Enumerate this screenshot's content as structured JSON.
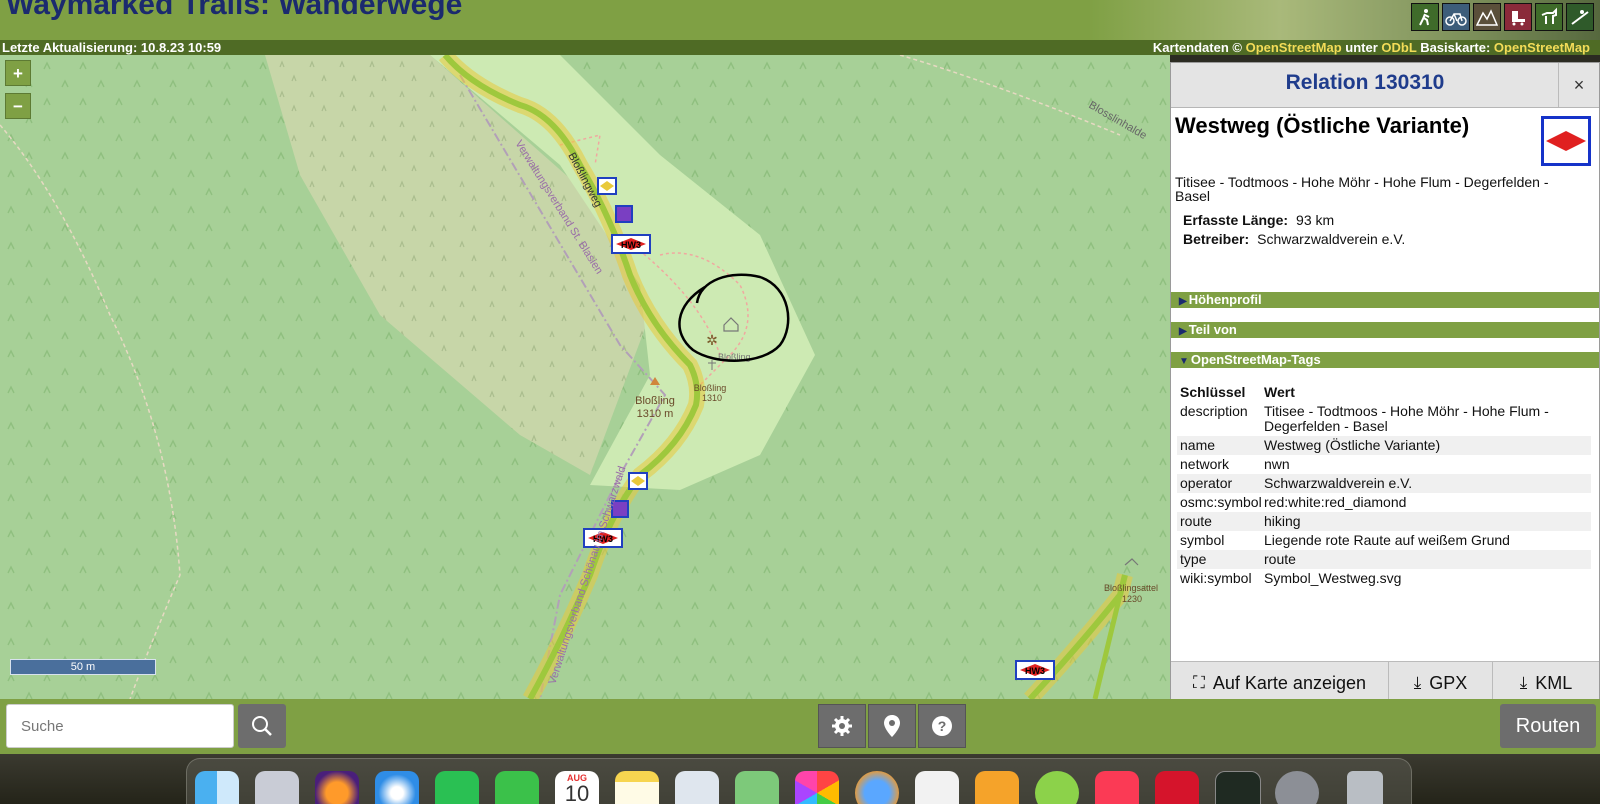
{
  "header": {
    "title": "Waymarked Trails: Wanderwege",
    "route_icons": [
      "hiking-icon",
      "cycling-icon",
      "mtb-icon",
      "skating-icon",
      "riding-icon",
      "slopes-icon"
    ],
    "last_update": "Letzte Aktualisierung: 10.8.23 10:59",
    "attribution": {
      "prefix": "Kartendaten ©",
      "osm": "OpenStreetMap",
      "under": "unter",
      "license": "ODbL",
      "base_label": "Basiskarte:",
      "base": "OpenStreetMap"
    }
  },
  "map": {
    "zoom_in": "+",
    "zoom_out": "−",
    "scale": "50 m",
    "labels": {
      "road": "Bloßlingweg",
      "admin1": "Verwaltungsverband St. Blasien",
      "admin2": "Verwaltungsverband Schönau im Schwarzwald",
      "peak_name": "Bloßling",
      "peak_ele": "1310 m",
      "peak2_name": "Bloßling",
      "peak2_ele": "1310",
      "shelter": "Bloßling",
      "east_road": "Blosslinhalde",
      "east_peak": "Bloßlingsattel",
      "east_peak_ele": "1230",
      "route_tag": "HW3"
    }
  },
  "panel": {
    "title": "Relation 130310",
    "close": "×",
    "route_name": "Westweg (Östliche Variante)",
    "description": "Titisee - Todtmoos - Hohe Möhr - Hohe Flum - Degerfelden - Basel",
    "length_label": "Erfasste Länge:",
    "length_value": "93 km",
    "operator_label": "Betreiber:",
    "operator_value": "Schwarzwaldverein e.V.",
    "sections": {
      "elevation": "Höhenprofil",
      "part_of": "Teil von",
      "osm_tags": "OpenStreetMap-Tags"
    },
    "tags_header": {
      "key": "Schlüssel",
      "value": "Wert"
    },
    "tags": [
      {
        "key": "description",
        "value": "Titisee - Todtmoos - Hohe Möhr - Hohe Flum - Degerfelden - Basel"
      },
      {
        "key": "name",
        "value": "Westweg (Östliche Variante)"
      },
      {
        "key": "network",
        "value": "nwn"
      },
      {
        "key": "operator",
        "value": "Schwarzwaldverein e.V."
      },
      {
        "key": "osmc:symbol",
        "value": "red:white:red_diamond"
      },
      {
        "key": "route",
        "value": "hiking"
      },
      {
        "key": "symbol",
        "value": "Liegende rote Raute auf weißem Grund"
      },
      {
        "key": "type",
        "value": "route"
      },
      {
        "key": "wiki:symbol",
        "value": "Symbol_Westweg.svg"
      }
    ],
    "footer": {
      "show_on_map": "Auf Karte anzeigen",
      "gpx": "GPX",
      "kml": "KML"
    }
  },
  "bottom_bar": {
    "search_placeholder": "Suche",
    "routes_button": "Routen"
  },
  "dock": {
    "calendar_month": "AUG",
    "calendar_day": "10",
    "apps": [
      "finder-icon",
      "launchpad-icon",
      "firefox-icon",
      "safari-icon",
      "whatsapp-icon",
      "facetime-icon",
      "calendar-icon",
      "notes-icon",
      "preview-icon",
      "maps-icon",
      "photos-icon",
      "network-icon",
      "textedit-icon",
      "pages-icon",
      "chameleon-icon",
      "music-icon",
      "avira-icon",
      "activity-monitor-icon",
      "system-settings-icon",
      "trash-icon"
    ]
  },
  "colors": {
    "brand_green": "#7fa044",
    "title_blue": "#1b2a6e",
    "link_yellow": "#f3dc58",
    "route_red": "#e02020",
    "symbol_border": "#1633c9"
  }
}
